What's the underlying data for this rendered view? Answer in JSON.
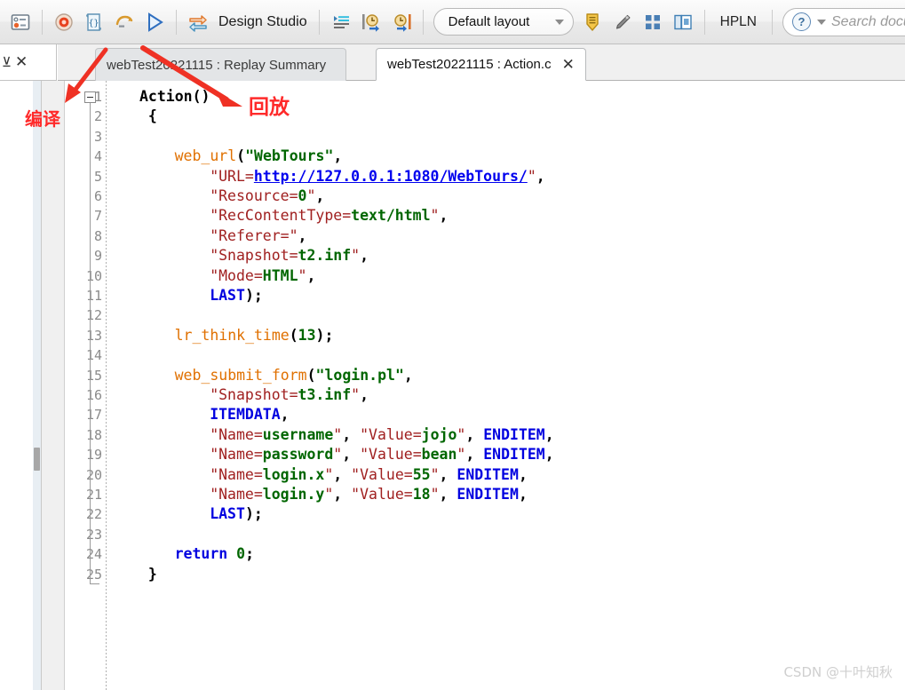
{
  "toolbar": {
    "icons_left": [
      {
        "name": "controller-icon",
        "title": "Controller"
      },
      {
        "name": "record-icon",
        "title": "Record"
      },
      {
        "name": "script-icon",
        "title": "Script"
      },
      {
        "name": "replay-loop-icon",
        "title": "Replay"
      },
      {
        "name": "run-icon",
        "title": "Run"
      }
    ],
    "design_studio_icon": "design-studio-icon",
    "design_studio_label": "Design Studio",
    "icons_mid": [
      {
        "name": "steps-toolbar-icon",
        "title": "Steps"
      },
      {
        "name": "think-time-start-icon",
        "title": "Think Time Start"
      },
      {
        "name": "think-time-end-icon",
        "title": "Think Time End"
      }
    ],
    "layout_label": "Default layout",
    "icons_right": [
      {
        "name": "bookmark-down-icon",
        "title": "Bookmark"
      },
      {
        "name": "pen-icon",
        "title": "Annotate"
      },
      {
        "name": "grid-icon",
        "title": "Grid"
      },
      {
        "name": "windows-icon",
        "title": "Windows"
      }
    ],
    "hpln_label": "HPLN",
    "help_icon": "help-circle-icon",
    "search_placeholder": "Search docume"
  },
  "left_stub": {
    "panel_icon": "panel-icon",
    "close_label": "✕"
  },
  "tabs": [
    {
      "name": "tab-replay-summary",
      "label": "webTest20221115 : Replay Summary",
      "active": false,
      "closable": false
    },
    {
      "name": "tab-action-c",
      "label": "webTest20221115 : Action.c",
      "active": true,
      "closable": true,
      "close_label": "✕"
    }
  ],
  "annotations": [
    {
      "name": "annotation-compile",
      "label": "编译"
    },
    {
      "name": "annotation-replay",
      "label": "回放"
    }
  ],
  "editor": {
    "line_numbers": [
      1,
      2,
      3,
      4,
      5,
      6,
      7,
      8,
      9,
      10,
      11,
      12,
      13,
      14,
      15,
      16,
      17,
      18,
      19,
      20,
      21,
      22,
      23,
      24,
      25
    ],
    "lines": [
      {
        "n": 1,
        "indent": 0,
        "tokens": [
          {
            "t": "Action",
            "c": "plain"
          },
          {
            "t": "()",
            "c": "punc"
          }
        ]
      },
      {
        "n": 2,
        "indent": 1,
        "tokens": [
          {
            "t": "{",
            "c": "punc"
          }
        ]
      },
      {
        "n": 3,
        "indent": 0,
        "tokens": []
      },
      {
        "n": 4,
        "indent": 4,
        "tokens": [
          {
            "t": "web_url",
            "c": "fn"
          },
          {
            "t": "(",
            "c": "punc"
          },
          {
            "t": "\"WebTours\"",
            "c": "val"
          },
          {
            "t": ",",
            "c": "punc"
          }
        ]
      },
      {
        "n": 5,
        "indent": 8,
        "tokens": [
          {
            "t": "\"URL=",
            "c": "str"
          },
          {
            "t": "http://127.0.0.1:1080/WebTours/",
            "c": "link"
          },
          {
            "t": "\"",
            "c": "str"
          },
          {
            "t": ",",
            "c": "punc"
          }
        ]
      },
      {
        "n": 6,
        "indent": 8,
        "tokens": [
          {
            "t": "\"Resource=",
            "c": "str"
          },
          {
            "t": "0",
            "c": "val"
          },
          {
            "t": "\"",
            "c": "str"
          },
          {
            "t": ",",
            "c": "punc"
          }
        ]
      },
      {
        "n": 7,
        "indent": 8,
        "tokens": [
          {
            "t": "\"RecContentType=",
            "c": "str"
          },
          {
            "t": "text/html",
            "c": "val"
          },
          {
            "t": "\"",
            "c": "str"
          },
          {
            "t": ",",
            "c": "punc"
          }
        ]
      },
      {
        "n": 8,
        "indent": 8,
        "tokens": [
          {
            "t": "\"Referer=\"",
            "c": "str"
          },
          {
            "t": ",",
            "c": "punc"
          }
        ]
      },
      {
        "n": 9,
        "indent": 8,
        "tokens": [
          {
            "t": "\"Snapshot=",
            "c": "str"
          },
          {
            "t": "t2.inf",
            "c": "val"
          },
          {
            "t": "\"",
            "c": "str"
          },
          {
            "t": ",",
            "c": "punc"
          }
        ]
      },
      {
        "n": 10,
        "indent": 8,
        "tokens": [
          {
            "t": "\"Mode=",
            "c": "str"
          },
          {
            "t": "HTML",
            "c": "val"
          },
          {
            "t": "\"",
            "c": "str"
          },
          {
            "t": ",",
            "c": "punc"
          }
        ]
      },
      {
        "n": 11,
        "indent": 8,
        "tokens": [
          {
            "t": "LAST",
            "c": "kw"
          },
          {
            "t": ");",
            "c": "punc"
          }
        ]
      },
      {
        "n": 12,
        "indent": 0,
        "tokens": []
      },
      {
        "n": 13,
        "indent": 4,
        "tokens": [
          {
            "t": "lr_think_time",
            "c": "fn"
          },
          {
            "t": "(",
            "c": "punc"
          },
          {
            "t": "13",
            "c": "val"
          },
          {
            "t": ");",
            "c": "punc"
          }
        ]
      },
      {
        "n": 14,
        "indent": 0,
        "tokens": []
      },
      {
        "n": 15,
        "indent": 4,
        "tokens": [
          {
            "t": "web_submit_form",
            "c": "fn"
          },
          {
            "t": "(",
            "c": "punc"
          },
          {
            "t": "\"login.pl\"",
            "c": "val"
          },
          {
            "t": ",",
            "c": "punc"
          }
        ]
      },
      {
        "n": 16,
        "indent": 8,
        "tokens": [
          {
            "t": "\"Snapshot=",
            "c": "str"
          },
          {
            "t": "t3.inf",
            "c": "val"
          },
          {
            "t": "\"",
            "c": "str"
          },
          {
            "t": ",",
            "c": "punc"
          }
        ]
      },
      {
        "n": 17,
        "indent": 8,
        "tokens": [
          {
            "t": "ITEMDATA",
            "c": "kw"
          },
          {
            "t": ",",
            "c": "punc"
          }
        ]
      },
      {
        "n": 18,
        "indent": 8,
        "tokens": [
          {
            "t": "\"Name=",
            "c": "str"
          },
          {
            "t": "username",
            "c": "val"
          },
          {
            "t": "\"",
            "c": "str"
          },
          {
            "t": ", ",
            "c": "punc"
          },
          {
            "t": "\"Value=",
            "c": "str"
          },
          {
            "t": "jojo",
            "c": "val"
          },
          {
            "t": "\"",
            "c": "str"
          },
          {
            "t": ", ",
            "c": "punc"
          },
          {
            "t": "ENDITEM",
            "c": "kw"
          },
          {
            "t": ",",
            "c": "punc"
          }
        ]
      },
      {
        "n": 19,
        "indent": 8,
        "tokens": [
          {
            "t": "\"Name=",
            "c": "str"
          },
          {
            "t": "password",
            "c": "val"
          },
          {
            "t": "\"",
            "c": "str"
          },
          {
            "t": ", ",
            "c": "punc"
          },
          {
            "t": "\"Value=",
            "c": "str"
          },
          {
            "t": "bean",
            "c": "val"
          },
          {
            "t": "\"",
            "c": "str"
          },
          {
            "t": ", ",
            "c": "punc"
          },
          {
            "t": "ENDITEM",
            "c": "kw"
          },
          {
            "t": ",",
            "c": "punc"
          }
        ]
      },
      {
        "n": 20,
        "indent": 8,
        "tokens": [
          {
            "t": "\"Name=",
            "c": "str"
          },
          {
            "t": "login.x",
            "c": "val"
          },
          {
            "t": "\"",
            "c": "str"
          },
          {
            "t": ", ",
            "c": "punc"
          },
          {
            "t": "\"Value=",
            "c": "str"
          },
          {
            "t": "55",
            "c": "val"
          },
          {
            "t": "\"",
            "c": "str"
          },
          {
            "t": ", ",
            "c": "punc"
          },
          {
            "t": "ENDITEM",
            "c": "kw"
          },
          {
            "t": ",",
            "c": "punc"
          }
        ]
      },
      {
        "n": 21,
        "indent": 8,
        "tokens": [
          {
            "t": "\"Name=",
            "c": "str"
          },
          {
            "t": "login.y",
            "c": "val"
          },
          {
            "t": "\"",
            "c": "str"
          },
          {
            "t": ", ",
            "c": "punc"
          },
          {
            "t": "\"Value=",
            "c": "str"
          },
          {
            "t": "18",
            "c": "val"
          },
          {
            "t": "\"",
            "c": "str"
          },
          {
            "t": ", ",
            "c": "punc"
          },
          {
            "t": "ENDITEM",
            "c": "kw"
          },
          {
            "t": ",",
            "c": "punc"
          }
        ]
      },
      {
        "n": 22,
        "indent": 8,
        "tokens": [
          {
            "t": "LAST",
            "c": "kw"
          },
          {
            "t": ");",
            "c": "punc"
          }
        ]
      },
      {
        "n": 23,
        "indent": 0,
        "tokens": []
      },
      {
        "n": 24,
        "indent": 4,
        "tokens": [
          {
            "t": "return",
            "c": "kw"
          },
          {
            "t": " ",
            "c": "punc"
          },
          {
            "t": "0",
            "c": "val"
          },
          {
            "t": ";",
            "c": "punc"
          }
        ]
      },
      {
        "n": 25,
        "indent": 1,
        "tokens": [
          {
            "t": "}",
            "c": "punc"
          }
        ]
      }
    ]
  },
  "watermark": "CSDN @十叶知秋"
}
